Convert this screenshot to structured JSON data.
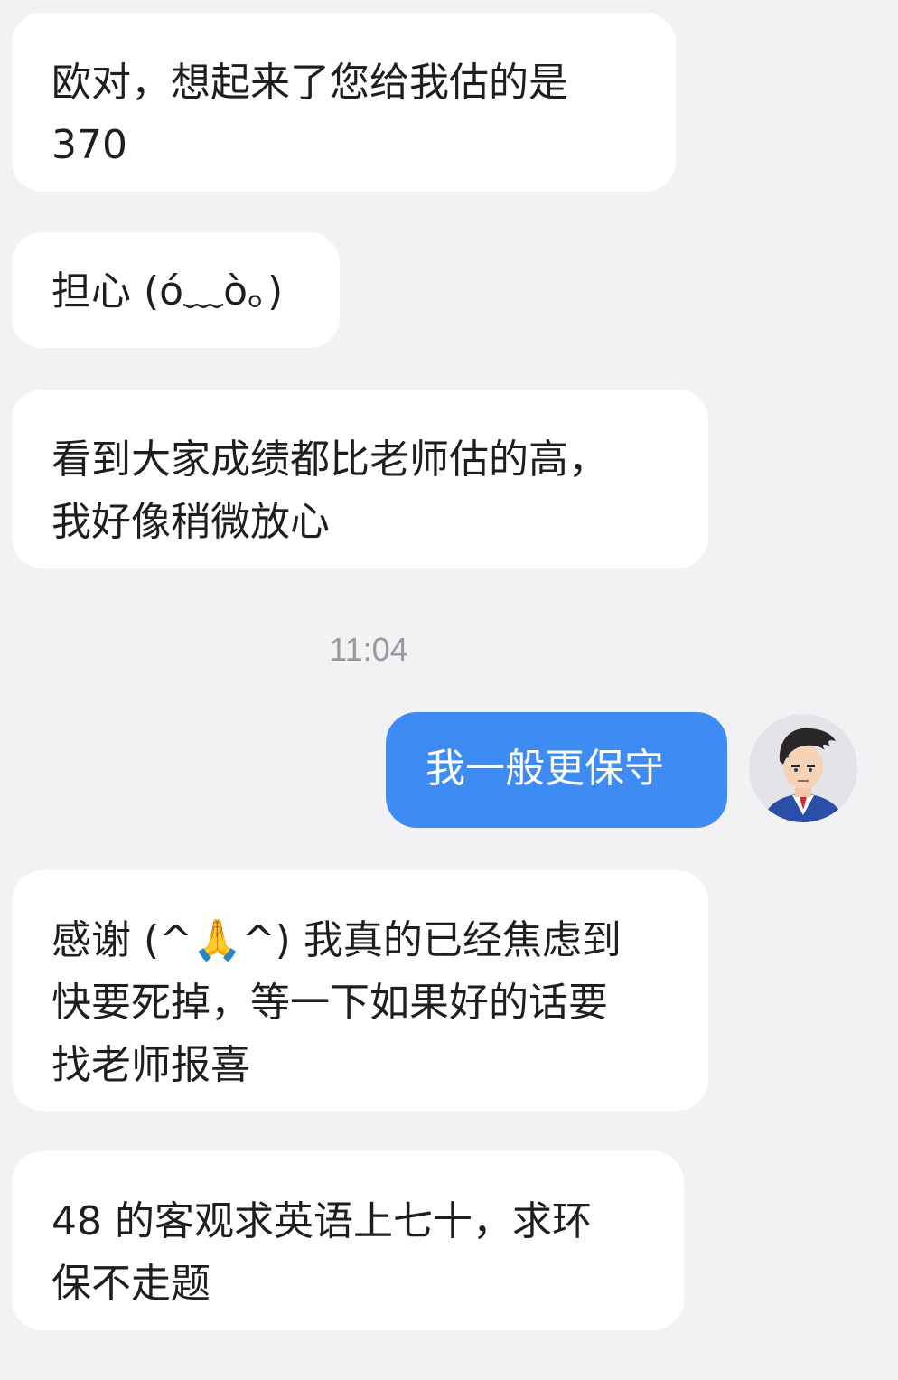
{
  "conversation": {
    "messages": [
      {
        "direction": "incoming",
        "text": "欧对，想起来了您给我估的是\n370"
      },
      {
        "direction": "incoming",
        "text": "担心 (ó﹏ò｡)"
      },
      {
        "direction": "incoming",
        "text": "看到大家成绩都比老师估的高，\n我好像稍微放心"
      },
      {
        "direction": "outgoing",
        "text": "我一般更保守"
      },
      {
        "direction": "incoming",
        "text": "感谢 (^🙏^) 我真的已经焦虑到\n快要死掉，等一下如果好的话要\n找老师报喜"
      },
      {
        "direction": "incoming",
        "text": "48 的客观求英语上七十，求环\n保不走题"
      }
    ],
    "timestamp": "11:04"
  },
  "colors": {
    "background": "#f2f2f4",
    "incoming_bubble": "#ffffff",
    "outgoing_bubble": "#3e8cf3",
    "timestamp_text": "#9a9a9e"
  },
  "icons": {
    "avatar": "user-avatar-icon"
  }
}
